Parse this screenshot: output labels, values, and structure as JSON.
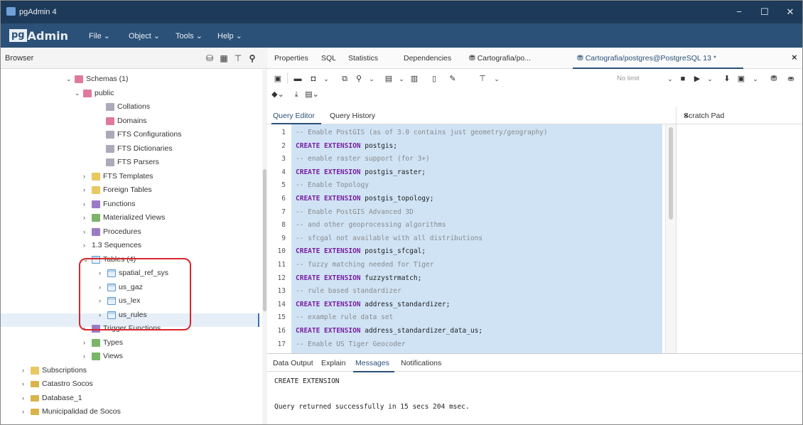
{
  "window": {
    "title": "pgAdmin 4",
    "minimize": "−",
    "maximize": "☐",
    "close": "✕"
  },
  "menubar": {
    "logo_pg": "pg",
    "logo_text": "Admin",
    "menus": [
      "File ⌄",
      "Object ⌄",
      "Tools ⌄",
      "Help ⌄"
    ]
  },
  "browser": {
    "label": "Browser",
    "icons": [
      "database-icon",
      "table-icon",
      "sql-icon",
      "search-icon"
    ],
    "tree": [
      {
        "label": "Schemas (1)",
        "toggle": "⌄",
        "icon": "pink"
      },
      {
        "label": "public",
        "toggle": "⌄",
        "icon": "pink"
      },
      {
        "label": "Collations",
        "toggle": "",
        "icon": "gray"
      },
      {
        "label": "Domains",
        "toggle": "",
        "icon": "pink"
      },
      {
        "label": "FTS Configurations",
        "toggle": "",
        "icon": "gray"
      },
      {
        "label": "FTS Dictionaries",
        "toggle": "",
        "icon": "gray"
      },
      {
        "label": "FTS Parsers",
        "toggle": "",
        "icon": "gray"
      },
      {
        "label": "FTS Templates",
        "toggle": "›",
        "icon": "folder"
      },
      {
        "label": "Foreign Tables",
        "toggle": "›",
        "icon": "folder"
      },
      {
        "label": "Functions",
        "toggle": "›",
        "icon": "purple"
      },
      {
        "label": "Materialized Views",
        "toggle": "›",
        "icon": "green"
      },
      {
        "label": "Procedures",
        "toggle": "›",
        "icon": "purple"
      },
      {
        "label": "1.3 Sequences",
        "toggle": "›",
        "icon": ""
      },
      {
        "label": "Tables (4)",
        "toggle": "⌄",
        "icon": "table"
      },
      {
        "label": "spatial_ref_sys",
        "toggle": "›",
        "icon": "table"
      },
      {
        "label": "us_gaz",
        "toggle": "›",
        "icon": "table"
      },
      {
        "label": "us_lex",
        "toggle": "›",
        "icon": "table"
      },
      {
        "label": "us_rules",
        "toggle": "›",
        "icon": "table"
      },
      {
        "label": "Trigger Functions",
        "toggle": "›",
        "icon": "purple"
      },
      {
        "label": "Types",
        "toggle": "›",
        "icon": "green"
      },
      {
        "label": "Views",
        "toggle": "›",
        "icon": "green"
      },
      {
        "label": "Subscriptions",
        "toggle": "›",
        "icon": "folder"
      },
      {
        "label": "Catastro Socos",
        "toggle": "›",
        "icon": "db"
      },
      {
        "label": "Database_1",
        "toggle": "›",
        "icon": "db"
      },
      {
        "label": "Municipalidad de Socos",
        "toggle": "›",
        "icon": "db"
      }
    ]
  },
  "tabs": [
    "Properties",
    "SQL",
    "Statistics",
    "Dependencies",
    "Cartografia/po...",
    "Cartografia/postgres@PostgreSQL 13 *"
  ],
  "tabs_close": "×",
  "toolbar": {
    "nolimit": "No limit",
    "icons": [
      "save-icon",
      "open-folder-icon",
      "save-disk-icon",
      "chevron-down-icon",
      "copy-icon",
      "find-icon",
      "chevron-down-icon",
      "copy-rows-icon",
      "chevron-down-icon",
      "paste-icon",
      "delete-icon",
      "edit-icon",
      "filter-icon",
      "chevron-down-icon",
      "stop-icon",
      "execute-icon",
      "chevron-down-icon",
      "explain-icon",
      "explain-analyze-icon",
      "chevron-down-icon",
      "commit-icon",
      "rollback-icon",
      "clear-icon",
      "download-icon",
      "macros-icon"
    ]
  },
  "query_tabs": [
    "Query Editor",
    "Query History"
  ],
  "scratch": {
    "label": "Scratch Pad",
    "close": "×"
  },
  "editor": {
    "lines": [
      {
        "n": "1",
        "kind": "cmt",
        "text": "-- Enable PostGIS (as of 3.0 contains just geometry/geography)"
      },
      {
        "n": "2",
        "kind": "code",
        "kw": "CREATE EXTENSION",
        "text": " postgis;"
      },
      {
        "n": "3",
        "kind": "cmt",
        "text": "-- enable raster support (for 3+)"
      },
      {
        "n": "4",
        "kind": "code",
        "kw": "CREATE EXTENSION",
        "text": " postgis_raster;"
      },
      {
        "n": "5",
        "kind": "cmt",
        "text": "-- Enable Topology"
      },
      {
        "n": "6",
        "kind": "code",
        "kw": "CREATE EXTENSION",
        "text": " postgis_topology;"
      },
      {
        "n": "7",
        "kind": "cmt",
        "text": "-- Enable PostGIS Advanced 3D"
      },
      {
        "n": "8",
        "kind": "cmt",
        "text": "-- and other geoprocessing algorithms"
      },
      {
        "n": "9",
        "kind": "cmt",
        "text": "-- sfcgal not available with all distributions"
      },
      {
        "n": "10",
        "kind": "code",
        "kw": "CREATE EXTENSION",
        "text": " postgis_sfcgal;"
      },
      {
        "n": "11",
        "kind": "cmt",
        "text": "-- fuzzy matching needed for Tiger"
      },
      {
        "n": "12",
        "kind": "code",
        "kw": "CREATE EXTENSION",
        "text": " fuzzystrmatch;"
      },
      {
        "n": "13",
        "kind": "cmt",
        "text": "-- rule based standardizer"
      },
      {
        "n": "14",
        "kind": "code",
        "kw": "CREATE EXTENSION",
        "text": " address_standardizer;"
      },
      {
        "n": "15",
        "kind": "cmt",
        "text": "-- example rule data set"
      },
      {
        "n": "16",
        "kind": "code",
        "kw": "CREATE EXTENSION",
        "text": " address_standardizer_data_us;"
      },
      {
        "n": "17",
        "kind": "cmt",
        "text": "-- Enable US Tiger Geocoder"
      }
    ]
  },
  "bottom_tabs": [
    "Data Output",
    "Explain",
    "Messages",
    "Notifications"
  ],
  "output": {
    "line1": "CREATE EXTENSION",
    "line2": "Query returned successfully in 15 secs 204 msec."
  }
}
